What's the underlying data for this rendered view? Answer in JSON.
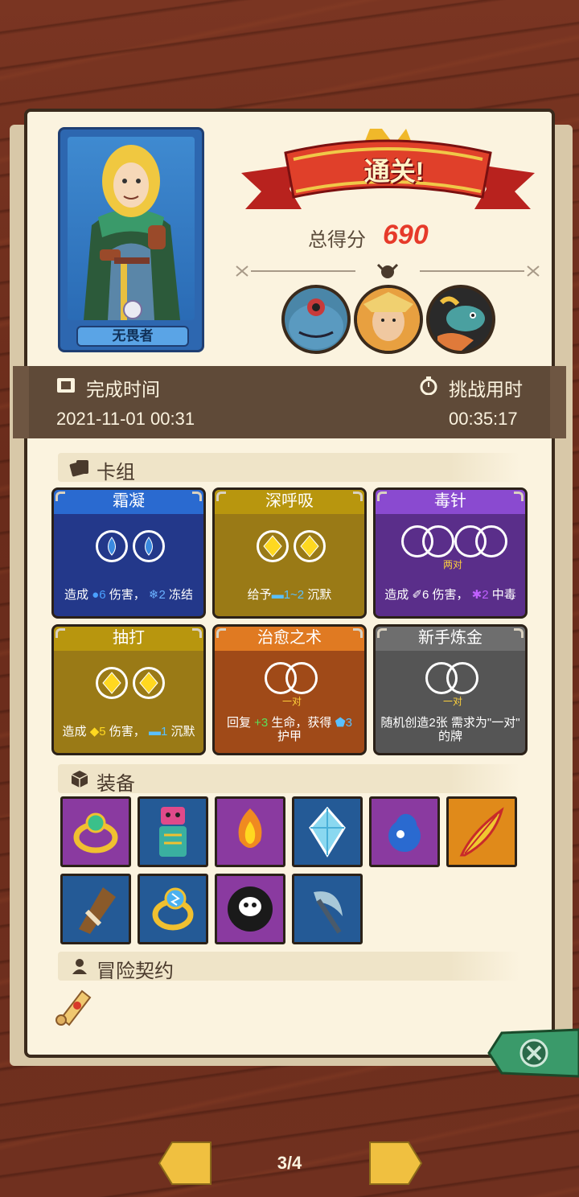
{
  "hero": {
    "name": "无畏者"
  },
  "result": {
    "banner": "通关!",
    "score_label": "总得分",
    "score": "690"
  },
  "bosses": [
    "boss-1-portrait",
    "boss-2-portrait",
    "boss-3-portrait"
  ],
  "info": {
    "finish_label": "完成时间",
    "finish_value": "2021-11-01 00:31",
    "duration_label": "挑战用时",
    "duration_value": "00:35:17"
  },
  "deck": {
    "title": "卡组",
    "cards": [
      {
        "title": "霜凝",
        "color": "#2255aa",
        "desc_parts": [
          "造成 ",
          "6",
          " 伤害， ",
          "2",
          " 冻结"
        ]
      },
      {
        "title": "深呼吸",
        "color": "#a88a10",
        "desc_parts": [
          "给予",
          "1~2",
          " 沉默"
        ]
      },
      {
        "title": "毒针",
        "color": "#6a3aa8",
        "pair": "两对",
        "desc_parts": [
          "造成 ",
          "6",
          " 伤害， ",
          "2",
          " 中毒"
        ]
      },
      {
        "title": "抽打",
        "color": "#a88a10",
        "desc_parts": [
          "造成 ",
          "5",
          " 伤害， ",
          "1",
          " 沉默"
        ]
      },
      {
        "title": "治愈之术",
        "color": "#b4561c",
        "pair": "一对",
        "desc_line1_parts": [
          "回复 ",
          "+3",
          " 生命，获得 ",
          "3"
        ],
        "desc_line2": "护甲"
      },
      {
        "title": "新手炼金",
        "color": "#5e5e5e",
        "pair": "一对",
        "desc_line1": "随机创造2张 需求为\"一对\"",
        "desc_line2": "的牌"
      }
    ]
  },
  "equipment": {
    "title": "装备",
    "items": [
      {
        "name": "emerald-ring",
        "bg": "#8a3aa0"
      },
      {
        "name": "totem",
        "bg": "#245a96"
      },
      {
        "name": "fire-bomb",
        "bg": "#8a3aa0"
      },
      {
        "name": "blue-gem",
        "bg": "#245a96"
      },
      {
        "name": "blue-flame-orb",
        "bg": "#8a3aa0"
      },
      {
        "name": "phoenix-feather",
        "bg": "#e08a1a"
      },
      {
        "name": "horn-cup",
        "bg": "#245a96"
      },
      {
        "name": "lightning-ring",
        "bg": "#245a96"
      },
      {
        "name": "dark-skull",
        "bg": "#8a3aa0"
      },
      {
        "name": "scythe-blade",
        "bg": "#245a96"
      }
    ]
  },
  "contract": {
    "title": "冒险契约"
  },
  "pager": {
    "indicator": "3/4"
  }
}
